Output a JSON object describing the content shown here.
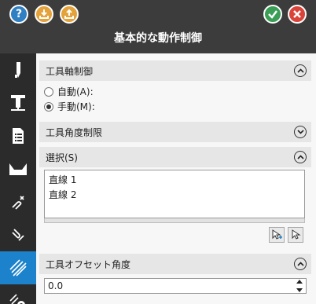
{
  "window": {
    "title": "基本的な動作制御"
  },
  "titlebar": {
    "help_icon_text": "?",
    "icons": [
      "help-icon",
      "import-icon",
      "export-icon",
      "ok-icon",
      "cancel-icon"
    ]
  },
  "sidebar": {
    "items": [
      {
        "icon": "tool-icon"
      },
      {
        "icon": "tool-holder-icon"
      },
      {
        "icon": "document-list-icon"
      },
      {
        "icon": "stock-icon"
      },
      {
        "icon": "lead-in-icon"
      },
      {
        "icon": "lead-out-icon"
      },
      {
        "icon": "hatch-pattern-icon",
        "active": true
      },
      {
        "icon": "settings-icon"
      }
    ]
  },
  "tool_axis_control": {
    "header": "工具軸制御",
    "options": [
      {
        "label": "自動(A):",
        "checked": false
      },
      {
        "label": "手動(M):",
        "checked": true
      }
    ]
  },
  "tool_angle_limit": {
    "header": "工具角度制限"
  },
  "selection": {
    "header": "選択(S)",
    "items": [
      "直線 1",
      "直線 2"
    ]
  },
  "tool_offset_angle": {
    "header": "工具オフセット角度",
    "value": "0.0"
  },
  "colors": {
    "titlebar": "#3c3c3c",
    "sidebar": "#2b2b2b",
    "active": "#1d82cc",
    "ok": "#3a9e56",
    "cancel": "#d9433a",
    "import_export": "#e4a23a",
    "help": "#2f7fc3"
  }
}
